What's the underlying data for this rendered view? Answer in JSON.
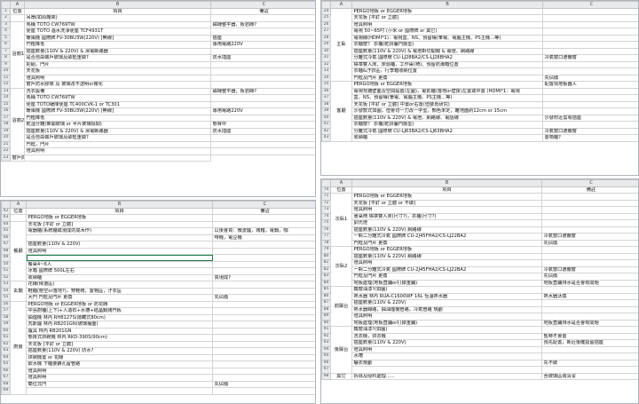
{
  "columns": {
    "a": "A",
    "b": "B",
    "c": "C"
  },
  "headers": {
    "pos": "位置",
    "item": "項目",
    "note": "備註"
  },
  "windows": [
    {
      "first_row": 1,
      "blocks": [
        {
          "label": "",
          "span": 1,
          "rows": [
            {
              "b": "項目",
              "c": "備註",
              "hdr": true
            }
          ]
        },
        {
          "label": "",
          "span": 1,
          "rows": [
            {
              "b": "吊扇(如原廠來)",
              "c": ""
            }
          ]
        },
        {
          "label": "浴廁1",
          "span": 10,
          "rows": [
            {
              "b": "馬桶 TOTO CW769TW",
              "c": "磁磚整平器，板岩磚?"
            },
            {
              "b": "便座 TOTO 溫水洗淨便座 TCF4931T",
              "c": ""
            },
            {
              "b": "暖風機 國際牌 FV-30BU3W(220V) [無線]",
              "c": "插座"
            },
            {
              "b": "門檻降低",
              "c": "專用電路220V"
            },
            {
              "b": "插座數量(110V & 220V) & 濕電斷路器",
              "c": ""
            },
            {
              "b": "是否自由做戶玻璃及歌框重做?",
              "c": "防水插座"
            },
            {
              "b": "把組，門片",
              "c": ""
            },
            {
              "b": "天花板",
              "c": ""
            },
            {
              "b": "燈具照明",
              "c": ""
            },
            {
              "b": "窗戶防水膠條 及 玻璃改不透明or霧化",
              "c": ""
            }
          ]
        },
        {
          "label": "浴廁2",
          "span": 10,
          "rows": [
            {
              "b": "洗衣設備",
              "c": "磁磚整平器，板岩磚?"
            },
            {
              "b": "馬桶 TOTO CW769TW",
              "c": ""
            },
            {
              "b": "便座 TOTO緩降便座 TC400CVK-1 or TC301",
              "c": ""
            },
            {
              "b": "暖風機 國際牌 FV-30BU3W(220V) [無線]",
              "c": "專用電路220V"
            },
            {
              "b": "門檻降低",
              "c": ""
            },
            {
              "b": "乾溼分離(推開玻璃 or 半片玻璃隔間)",
              "c": "懸臂中"
            },
            {
              "b": "插座數量(110V & 220V) & 濕電斷路器",
              "c": "防水插座"
            },
            {
              "b": "是否自由做戶玻璃及歌框重做?",
              "c": ""
            },
            {
              "b": "門框，門片",
              "c": ""
            },
            {
              "b": "燈具照明",
              "c": ""
            },
            {
              "b": "窗戶防水膠條 及 玻璃改不透明or霧化",
              "c": ""
            }
          ]
        }
      ]
    },
    {
      "first_row": 24,
      "blocks": [
        {
          "label": "主臥",
          "span": 11,
          "rows": [
            {
              "b": "PERGO地板 or EGGER地板",
              "c": ""
            },
            {
              "b": "天花板 [平釘 or 立體]",
              "c": ""
            },
            {
              "b": "燈具照明",
              "c": ""
            },
            {
              "b": "電視 50~65吋 (小米 or 國際牌 or 其它)",
              "c": ""
            },
            {
              "b": "電視線(HDMI*1)：電視盒、NS、預留權(筆電、電腦主機、PS主機…等)",
              "c": ""
            },
            {
              "b": "衣櫃窗？ 衣櫃(乾拚屬門層型)",
              "c": ""
            },
            {
              "b": "插座數量(110V & 220V) & 電燈對切開關 & 電燈、網路線",
              "c": ""
            },
            {
              "b": "分離式冷氣 國際牌 CU-LJ28BA2/CS-LJ28BHA2",
              "c": "冷氣窗口遮蔽窗"
            },
            {
              "b": "標準雙人床、床頭櫃、工作桌(椅)、預留防潮箱位置",
              "c": ""
            },
            {
              "b": "衣櫃&汙衣區，行李箱收納位置",
              "c": ""
            },
            {
              "b": "門框及門片 更換",
              "c": "先佔價"
            }
          ]
        },
        {
          "label": "客廳",
          "span": 9,
          "rows": [
            {
              "b": "PERGO地板 or EGGER地板",
              "c": "配置項地板器人"
            },
            {
              "b": "電視背牆壁面及空間設置(左圖)，電影櫃(落地or壁掛)左置或中置 (HDMI*1：電視",
              "c": ""
            },
            {
              "b": "盒、NS、預留權(筆電、電腦主機、PS主機…等)",
              "c": ""
            },
            {
              "b": "天花板 [平釘 or 立體] 中置or右置(但要再研究)",
              "c": ""
            },
            {
              "b": "沙發款式如圖，但會切一刀改一字型，顏色未定，離地面約12cm or 15cm",
              "c": ""
            },
            {
              "b": "插座數量(110V & 220V) & 電燈、網路線、電話線",
              "c": "沙發附近需有插座"
            },
            {
              "b": "衣櫃窗？ 衣櫃(乾拚屬門層型)",
              "c": ""
            },
            {
              "b": "分離式冷氣 國際牌 CU-LJ63BA2/CS-LJ63BHA2",
              "c": "冷氣窗口遮蔽窗"
            },
            {
              "b": "收納櫃",
              "c": "置物櫃?"
            }
          ]
        }
      ]
    },
    {
      "first_row": 42,
      "blocks": [
        {
          "label": "",
          "span": 1,
          "rows": [
            {
              "b": "項目",
              "c": "備註",
              "hdr": true
            }
          ]
        },
        {
          "label": "",
          "span": 1,
          "rows": [
            {
              "b": "PERGO地板 or EGGER地板",
              "c": ""
            }
          ]
        },
        {
          "label": "餐廳",
          "span": 9,
          "rows": [
            {
              "b": "天花板 [平釘 or 立體]",
              "c": ""
            },
            {
              "b": "電器櫃(系統櫃或現成的成木作)",
              "c": "以後會買：微波爐，烤箱，電鍋，咖"
            },
            {
              "b": "",
              "c": "啡機，電豆機"
            },
            {
              "b": "插座數量(110V & 220V)",
              "c": ""
            },
            {
              "b": "燈具照明",
              "c": ""
            },
            {
              "b": "",
              "c": "",
              "sel": true
            },
            {
              "b": "餐桌4~6人",
              "c": ""
            },
            {
              "b": "冰箱 國際牌 500L左右",
              "c": ""
            },
            {
              "b": "收納櫃",
              "c": "買現成?"
            }
          ]
        },
        {
          "label": "玄關",
          "span": 3,
          "rows": [
            {
              "b": "花磚(候選區)",
              "c": ""
            },
            {
              "b": "鞋櫃(懸空or落地?)，穿鞋椅，置物區，汙衣區",
              "c": ""
            },
            {
              "b": "大門 門框及門片 更換",
              "c": "先佔價"
            }
          ]
        },
        {
          "label": "廚房",
          "span": 14,
          "rows": [
            {
              "b": "PERGO地板 or EGGER地板 or 防花磚",
              "c": ""
            },
            {
              "b": "中島廚櫃(上下)+人造石+水槽+結晶鋼烤門板",
              "c": ""
            },
            {
              "b": "抽煙機 林內 RH8127S(隱藏式80cm)",
              "c": ""
            },
            {
              "b": "瓦斯爐 林內 RB201GN(玻璃檯面)",
              "c": ""
            },
            {
              "b": "爐具 林內 RB201GN",
              "c": ""
            },
            {
              "b": "懸掛式烘碗機 林內 RKD-390S(90cm)",
              "c": ""
            },
            {
              "b": "天花板 [平釘 or 立體]",
              "c": ""
            },
            {
              "b": "插座數量(110V & 220V) 防水?",
              "c": ""
            },
            {
              "b": "烘碗機置 or 花磚",
              "c": ""
            },
            {
              "b": "飲水機 下櫃要鑽孔留管路",
              "c": ""
            },
            {
              "b": "燈具照明",
              "c": ""
            },
            {
              "b": "燈具照明",
              "c": ""
            },
            {
              "b": "簡位式門",
              "c": "先佔價"
            },
            {
              "b": "",
              "c": ""
            }
          ]
        }
      ]
    },
    {
      "first_row": 70,
      "blocks": [
        {
          "label": "",
          "span": 1,
          "rows": [
            {
              "b": "項目",
              "c": "備註",
              "hdr": true
            }
          ]
        },
        {
          "label": "次臥1",
          "span": 8,
          "rows": [
            {
              "b": "PERGO地板 or EGGER地板",
              "c": ""
            },
            {
              "b": "天花板 [平釘 or 立體 or 不做]",
              "c": ""
            },
            {
              "b": "燈具照明",
              "c": ""
            },
            {
              "b": "書桌椅 標準雙人床(尺寸?)，衣櫃(尺寸?)",
              "c": ""
            },
            {
              "b": "調光燈",
              "c": ""
            },
            {
              "b": "插座數量(110V & 220V) 網路線",
              "c": ""
            },
            {
              "b": "一對二分離式冷氣 國際牌 CU-2J45FHA2/CS-LJ22BA2",
              "c": "冷氣窗口遮蔽窗"
            },
            {
              "b": "門框及門片 更換",
              "c": "先佔價"
            }
          ]
        },
        {
          "label": "次臥2",
          "span": 6,
          "rows": [
            {
              "b": "PERGO地板 or EGGER地板",
              "c": ""
            },
            {
              "b": "插座數量(110V & 220V) 網路線",
              "c": ""
            },
            {
              "b": "燈具照明",
              "c": ""
            },
            {
              "b": "一對二分離式冷氣 國際牌 CU-2J45FHA2/CS-LJ22BA2",
              "c": "冷氣窗口遮蔽窗"
            },
            {
              "b": "門框及門片 更換",
              "c": "先佔價"
            },
            {
              "b": "地板處理(地板直鋪or打掉重鋪)",
              "c": "地板直鋪排水是否會有問題"
            }
          ]
        },
        {
          "label": "前陽台",
          "span": 6,
          "rows": [
            {
              "b": "鐵窗油漆?(如圖)",
              "c": ""
            },
            {
              "b": "熱水器 林內 RUA-C1600WF 16L 恆溫熱水器",
              "c": "熱水器汰換"
            },
            {
              "b": "插座數量(110V & 220V)",
              "c": ""
            },
            {
              "b": "熱水器線路，抽油煙機管路，冷氣管路 規劃",
              "c": ""
            },
            {
              "b": "燈具照明",
              "c": ""
            },
            {
              "b": "地板處理(地板直鋪or打掉重鋪)",
              "c": "地板直鋪排水是否會有問題"
            }
          ]
        },
        {
          "label": "後陽台",
          "span": 7,
          "rows": [
            {
              "b": "鐵窗油漆?(如圖)",
              "c": ""
            },
            {
              "b": "洗衣機，烘衣機",
              "c": "暫時不會置"
            },
            {
              "b": "插座數量(110V & 220V)",
              "c": "預先配置，新近後確認留插座"
            },
            {
              "b": "燈具照明",
              "c": ""
            },
            {
              "b": "水槽",
              "c": ""
            },
            {
              "b": "曬衣規劃",
              "c": "先不做"
            },
            {
              "b": "",
              "c": ""
            }
          ]
        },
        {
          "label": "其它",
          "span": 1,
          "rows": [
            {
              "b": "拆除及廢料處理......",
              "c": "含玻璃區域清潔"
            }
          ]
        }
      ]
    }
  ]
}
